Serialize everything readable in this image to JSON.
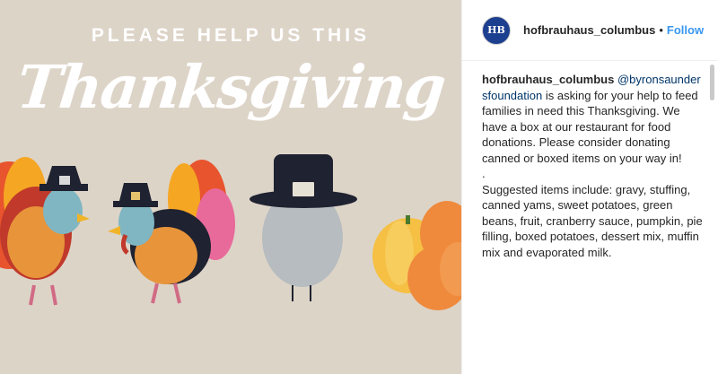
{
  "media": {
    "headline": "PLEASE HELP US THIS",
    "script_title": "Thanksgiving",
    "background_color": "#dcd3c7"
  },
  "header": {
    "avatar_text": "HB",
    "username": "hofbrauhaus_columbus",
    "separator": "•",
    "follow_label": "Follow"
  },
  "caption": {
    "username": "hofbrauhaus_columbus",
    "mention": "@byronsaunder sfoundation",
    "line1": " is asking for your help to feed families in need this Thanksgiving. We have a box at our restaurant for food donations. Please consider donating canned or boxed items on your way in!",
    "dot_line": ".",
    "line2": "Suggested items include: gravy, stuffing, canned yams, sweet potatoes, green beans, fruit, cranberry sauce, pumpkin, pie filling, boxed potatoes, dessert mix, muffin mix and evaporated milk."
  },
  "colors": {
    "accent": "#3897f0",
    "mention": "#003569"
  }
}
